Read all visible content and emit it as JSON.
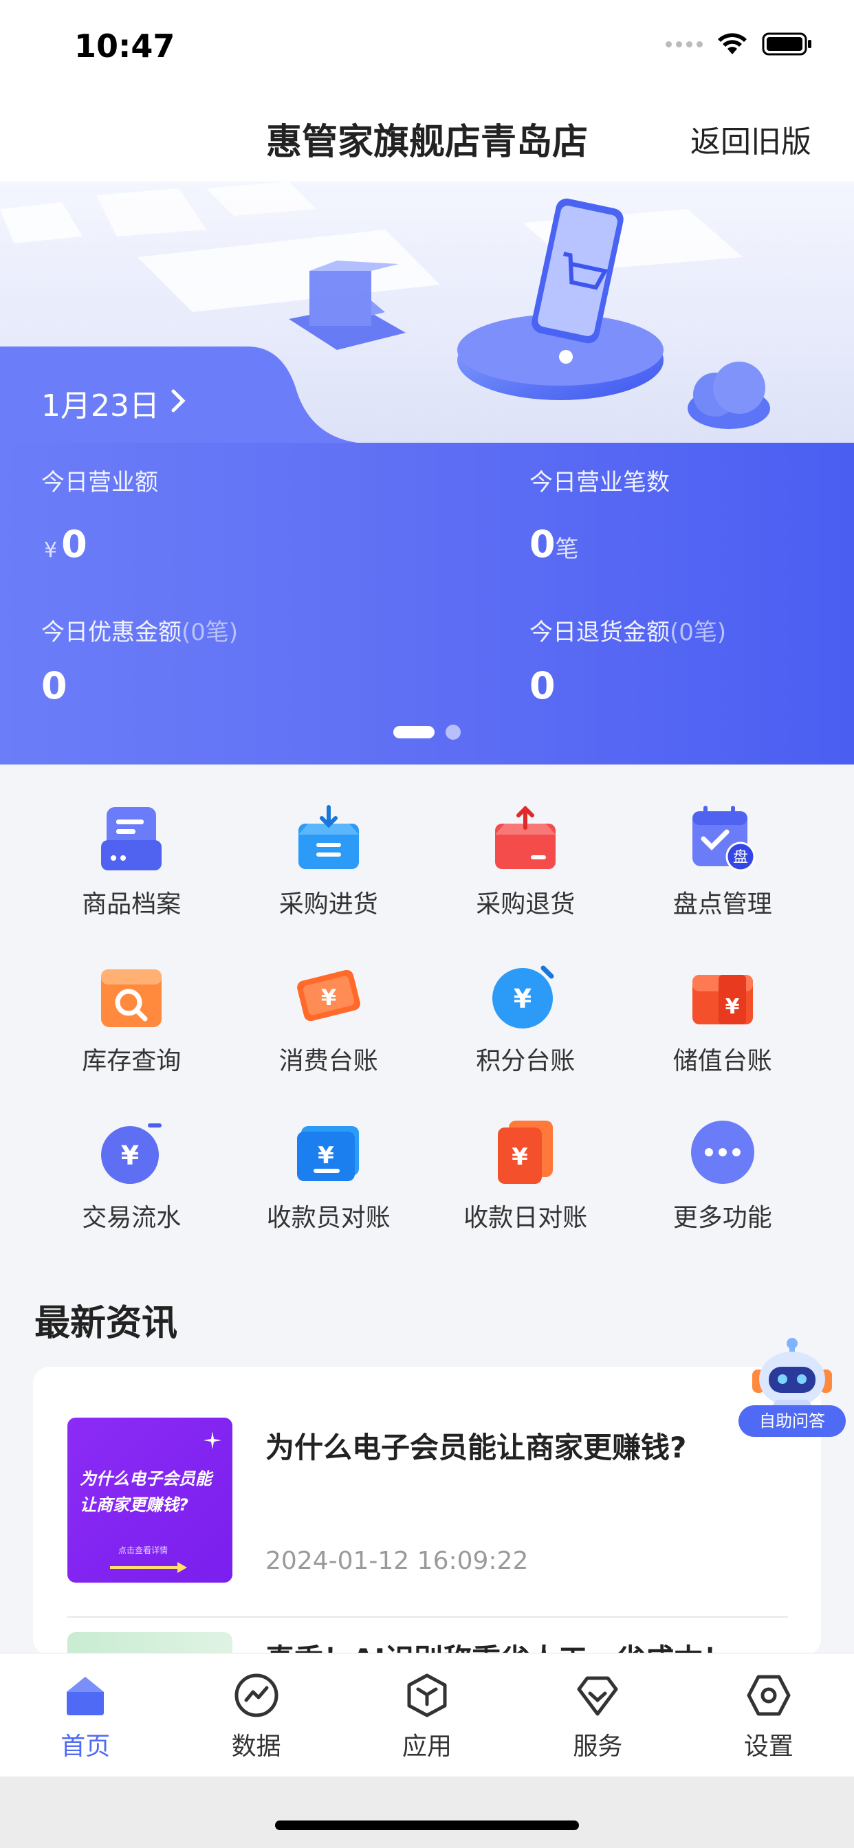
{
  "status_bar": {
    "time": "10:47"
  },
  "header": {
    "title": "惠管家旗舰店青岛店",
    "back_label": "返回旧版"
  },
  "dashboard": {
    "date": "1月23日",
    "stats": [
      {
        "label": "今日营业额",
        "sub": "",
        "value": "0",
        "prefix": "¥",
        "unit": ""
      },
      {
        "label": "今日营业笔数",
        "sub": "",
        "value": "0",
        "prefix": "",
        "unit": "笔"
      },
      {
        "label": "今日优惠金额",
        "sub": "(0笔)",
        "value": "0",
        "prefix": "",
        "unit": ""
      },
      {
        "label": "今日退货金额",
        "sub": "(0笔)",
        "value": "0",
        "prefix": "",
        "unit": ""
      }
    ],
    "pager": {
      "count": 2,
      "active": 1
    }
  },
  "functions": [
    {
      "label": "商品档案",
      "icon": "product-file-icon"
    },
    {
      "label": "采购进货",
      "icon": "purchase-in-icon"
    },
    {
      "label": "采购退货",
      "icon": "purchase-return-icon"
    },
    {
      "label": "盘点管理",
      "icon": "inventory-check-icon"
    },
    {
      "label": "库存查询",
      "icon": "stock-search-icon"
    },
    {
      "label": "消费台账",
      "icon": "consumption-ledger-icon"
    },
    {
      "label": "积分台账",
      "icon": "points-ledger-icon"
    },
    {
      "label": "储值台账",
      "icon": "stored-value-ledger-icon"
    },
    {
      "label": "交易流水",
      "icon": "transaction-flow-icon"
    },
    {
      "label": "收款员对账",
      "icon": "cashier-reconcile-icon"
    },
    {
      "label": "收款日对账",
      "icon": "daily-reconcile-icon"
    },
    {
      "label": "更多功能",
      "icon": "more-icon"
    }
  ],
  "news": {
    "section_title": "最新资讯",
    "items": [
      {
        "title": "为什么电子会员能让商家更赚钱?",
        "date": "2024-01-12 16:09:22",
        "thumb_text": "为什么电子会员能让商家更赚钱?",
        "thumb_hint": "点击查看详情"
      },
      {
        "title": "真香！AI识别称重省人工，省成本！"
      }
    ]
  },
  "assistant": {
    "label": "自助问答"
  },
  "tabbar": [
    {
      "label": "首页",
      "icon": "home-icon",
      "active": true
    },
    {
      "label": "数据",
      "icon": "data-chart-icon",
      "active": false
    },
    {
      "label": "应用",
      "icon": "apps-icon",
      "active": false
    },
    {
      "label": "服务",
      "icon": "service-icon",
      "active": false
    },
    {
      "label": "设置",
      "icon": "settings-icon",
      "active": false
    }
  ],
  "colors": {
    "primary": "#4f6af5",
    "panel": "#5f6ff4",
    "background": "#f4f5f9"
  }
}
